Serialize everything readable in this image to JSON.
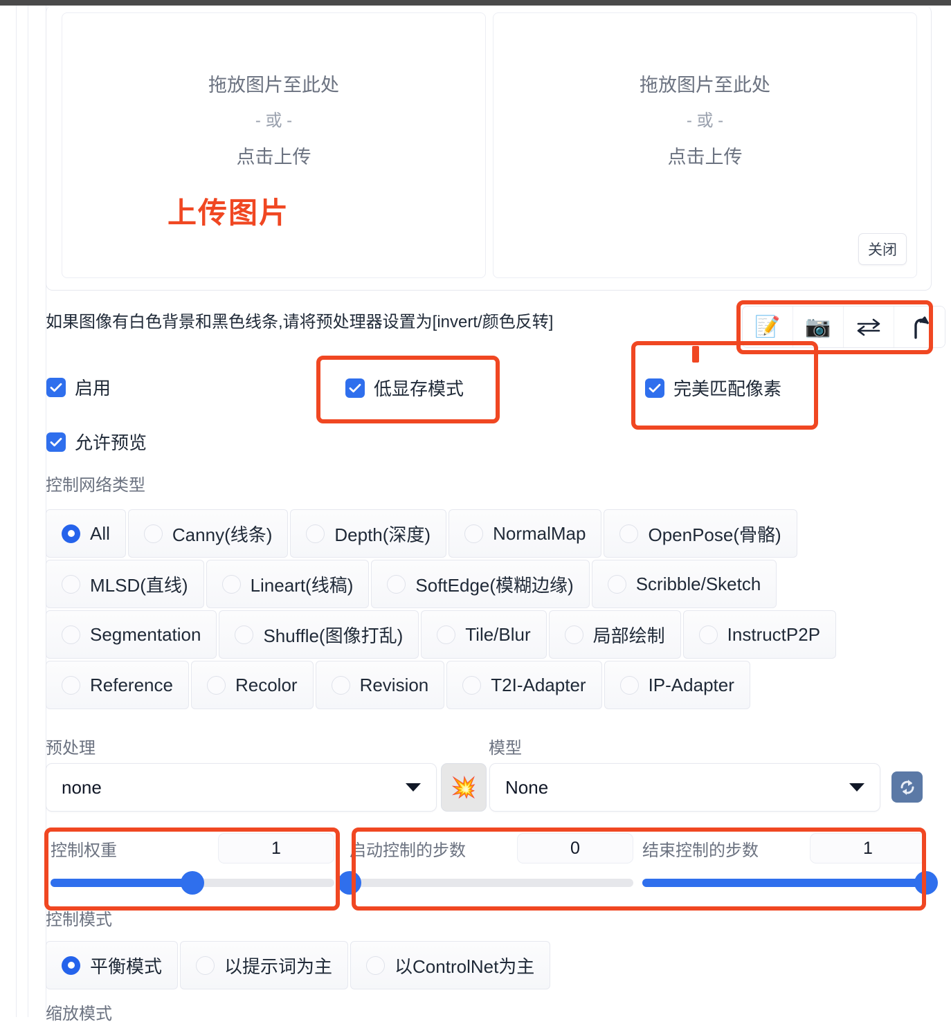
{
  "upload": {
    "drop_title": "拖放图片至此处",
    "drop_or": "- 或 -",
    "drop_click": "点击上传",
    "upload_label": "上传图片",
    "close_label": "关闭"
  },
  "hint": "如果图像有白色背景和黑色线条,请将预处理器设置为[invert/颜色反转]",
  "icon_bar": [
    {
      "name": "memo-pencil-icon",
      "glyph": "📝"
    },
    {
      "name": "camera-icon",
      "glyph": "📷"
    },
    {
      "name": "swap-arrows-icon",
      "glyph": "⇄"
    },
    {
      "name": "arrow-up-curve-icon",
      "glyph": "⤴"
    }
  ],
  "checkboxes": [
    {
      "name": "enable",
      "label": "启用",
      "checked": true
    },
    {
      "name": "allow-preview",
      "label": "允许预览",
      "checked": true
    },
    {
      "name": "low-vram",
      "label": "低显存模式",
      "checked": true
    },
    {
      "name": "pixel-perfect",
      "label": "完美匹配像素",
      "checked": true
    }
  ],
  "control_type": {
    "label": "控制网络类型",
    "selected": "All",
    "rows": [
      [
        "All",
        "Canny(线条)",
        "Depth(深度)",
        "NormalMap",
        "OpenPose(骨骼)"
      ],
      [
        "MLSD(直线)",
        "Lineart(线稿)",
        "SoftEdge(模糊边缘)",
        "Scribble/Sketch"
      ],
      [
        "Segmentation",
        "Shuffle(图像打乱)",
        "Tile/Blur",
        "局部绘制",
        "InstructP2P"
      ],
      [
        "Reference",
        "Recolor",
        "Revision",
        "T2I-Adapter",
        "IP-Adapter"
      ]
    ]
  },
  "preprocessor": {
    "label": "预处理",
    "value": "none"
  },
  "model": {
    "label": "模型",
    "value": "None"
  },
  "buttons": {
    "spark_glyph": "💥",
    "refresh_name": "refresh-models-button"
  },
  "sliders": [
    {
      "name": "control-weight",
      "label": "控制权重",
      "value": "1",
      "percent": 50
    },
    {
      "name": "start-control-step",
      "label": "启动控制的步数",
      "value": "0",
      "percent": 0
    },
    {
      "name": "end-control-step",
      "label": "结束控制的步数",
      "value": "1",
      "percent": 100
    }
  ],
  "control_mode": {
    "label": "控制模式",
    "selected": "平衡模式",
    "options": [
      "平衡模式",
      "以提示词为主",
      "以ControlNet为主"
    ]
  },
  "resize_mode": {
    "label": "缩放模式"
  },
  "colors": {
    "accent_blue": "#2f6fed",
    "annotation_red": "#f04722",
    "upload_red": "#f04722"
  }
}
